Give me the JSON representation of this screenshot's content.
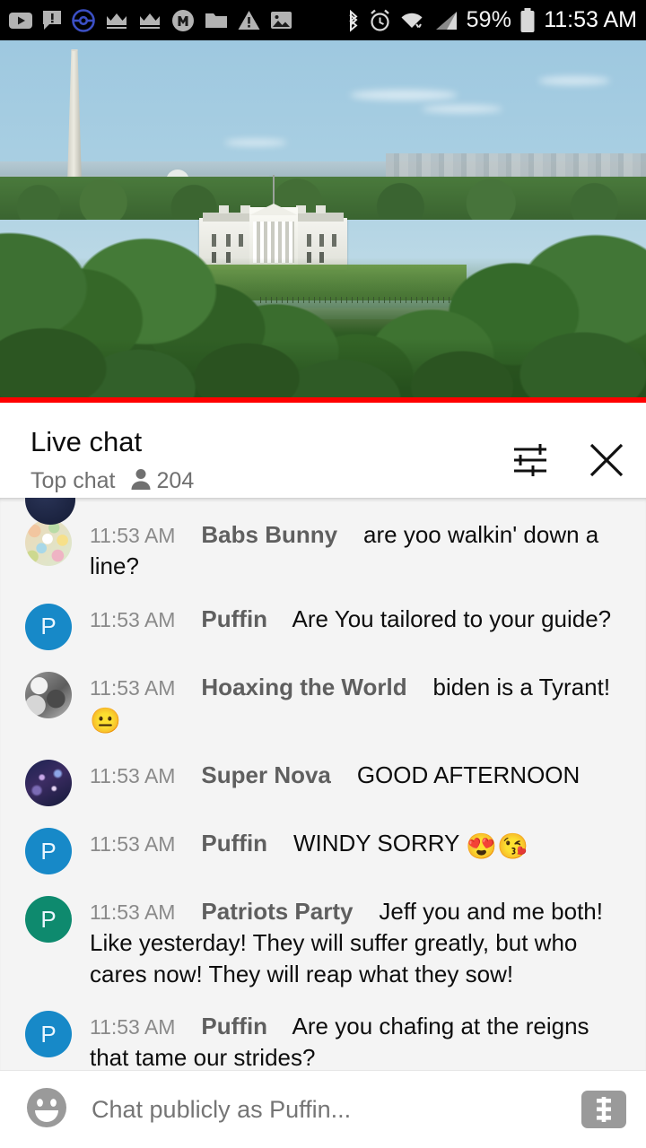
{
  "status_bar": {
    "icons": [
      "youtube-icon",
      "message-alert-icon",
      "pokeball-icon",
      "crown-icon",
      "crown-icon",
      "m-circle-icon",
      "folder-icon",
      "warning-triangle-icon",
      "image-icon"
    ],
    "right_icons": [
      "bluetooth-icon",
      "alarm-icon",
      "wifi-icon",
      "signal-icon"
    ],
    "battery_percent": "59%",
    "clock": "11:53 AM"
  },
  "video": {
    "scene": "White House with Washington Monument",
    "progress_color": "#ff0000"
  },
  "chat_header": {
    "title": "Live chat",
    "mode": "Top chat",
    "viewer_count": "204",
    "settings_icon": "tune-sliders-icon",
    "close_icon": "close-icon"
  },
  "messages": [
    {
      "time": "11:53 AM",
      "author": "Babs Bunny",
      "text": "are yoo walkin' down a line?",
      "avatar_type": "collage",
      "avatar_initial": ""
    },
    {
      "time": "11:53 AM",
      "author": "Puffin",
      "text": "Are You tailored to your guide?",
      "avatar_type": "puffin",
      "avatar_initial": "P"
    },
    {
      "time": "11:53 AM",
      "author": "Hoaxing the World",
      "text": "biden is a Tyrant!",
      "emojis": "😐",
      "avatar_type": "gray",
      "avatar_initial": ""
    },
    {
      "time": "11:53 AM",
      "author": "Super Nova",
      "text": "GOOD AFTERNOON",
      "avatar_type": "galaxy",
      "avatar_initial": ""
    },
    {
      "time": "11:53 AM",
      "author": "Puffin",
      "text": "WINDY SORRY ",
      "emojis": "😍😘",
      "avatar_type": "puffin",
      "avatar_initial": "P"
    },
    {
      "time": "11:53 AM",
      "author": "Patriots Party",
      "text": "Jeff you and me both! Like yesterday! They will suffer greatly, but who cares now! They will reap what they sow!",
      "avatar_type": "patriots",
      "avatar_initial": "P"
    },
    {
      "time": "11:53 AM",
      "author": "Puffin",
      "text": "Are you chafing at the reigns that tame our strides?",
      "avatar_type": "puffin",
      "avatar_initial": "P"
    }
  ],
  "input_bar": {
    "emoji_icon": "smiley-face-icon",
    "placeholder": "Chat publicly as Puffin...",
    "value": "",
    "superchat_icon": "dollar-sign-icon"
  },
  "colors": {
    "accent_red": "#ff0000",
    "puffin_blue": "#1789c8",
    "patriots_teal": "#0e8a6e",
    "chat_bg": "#f4f4f4"
  }
}
